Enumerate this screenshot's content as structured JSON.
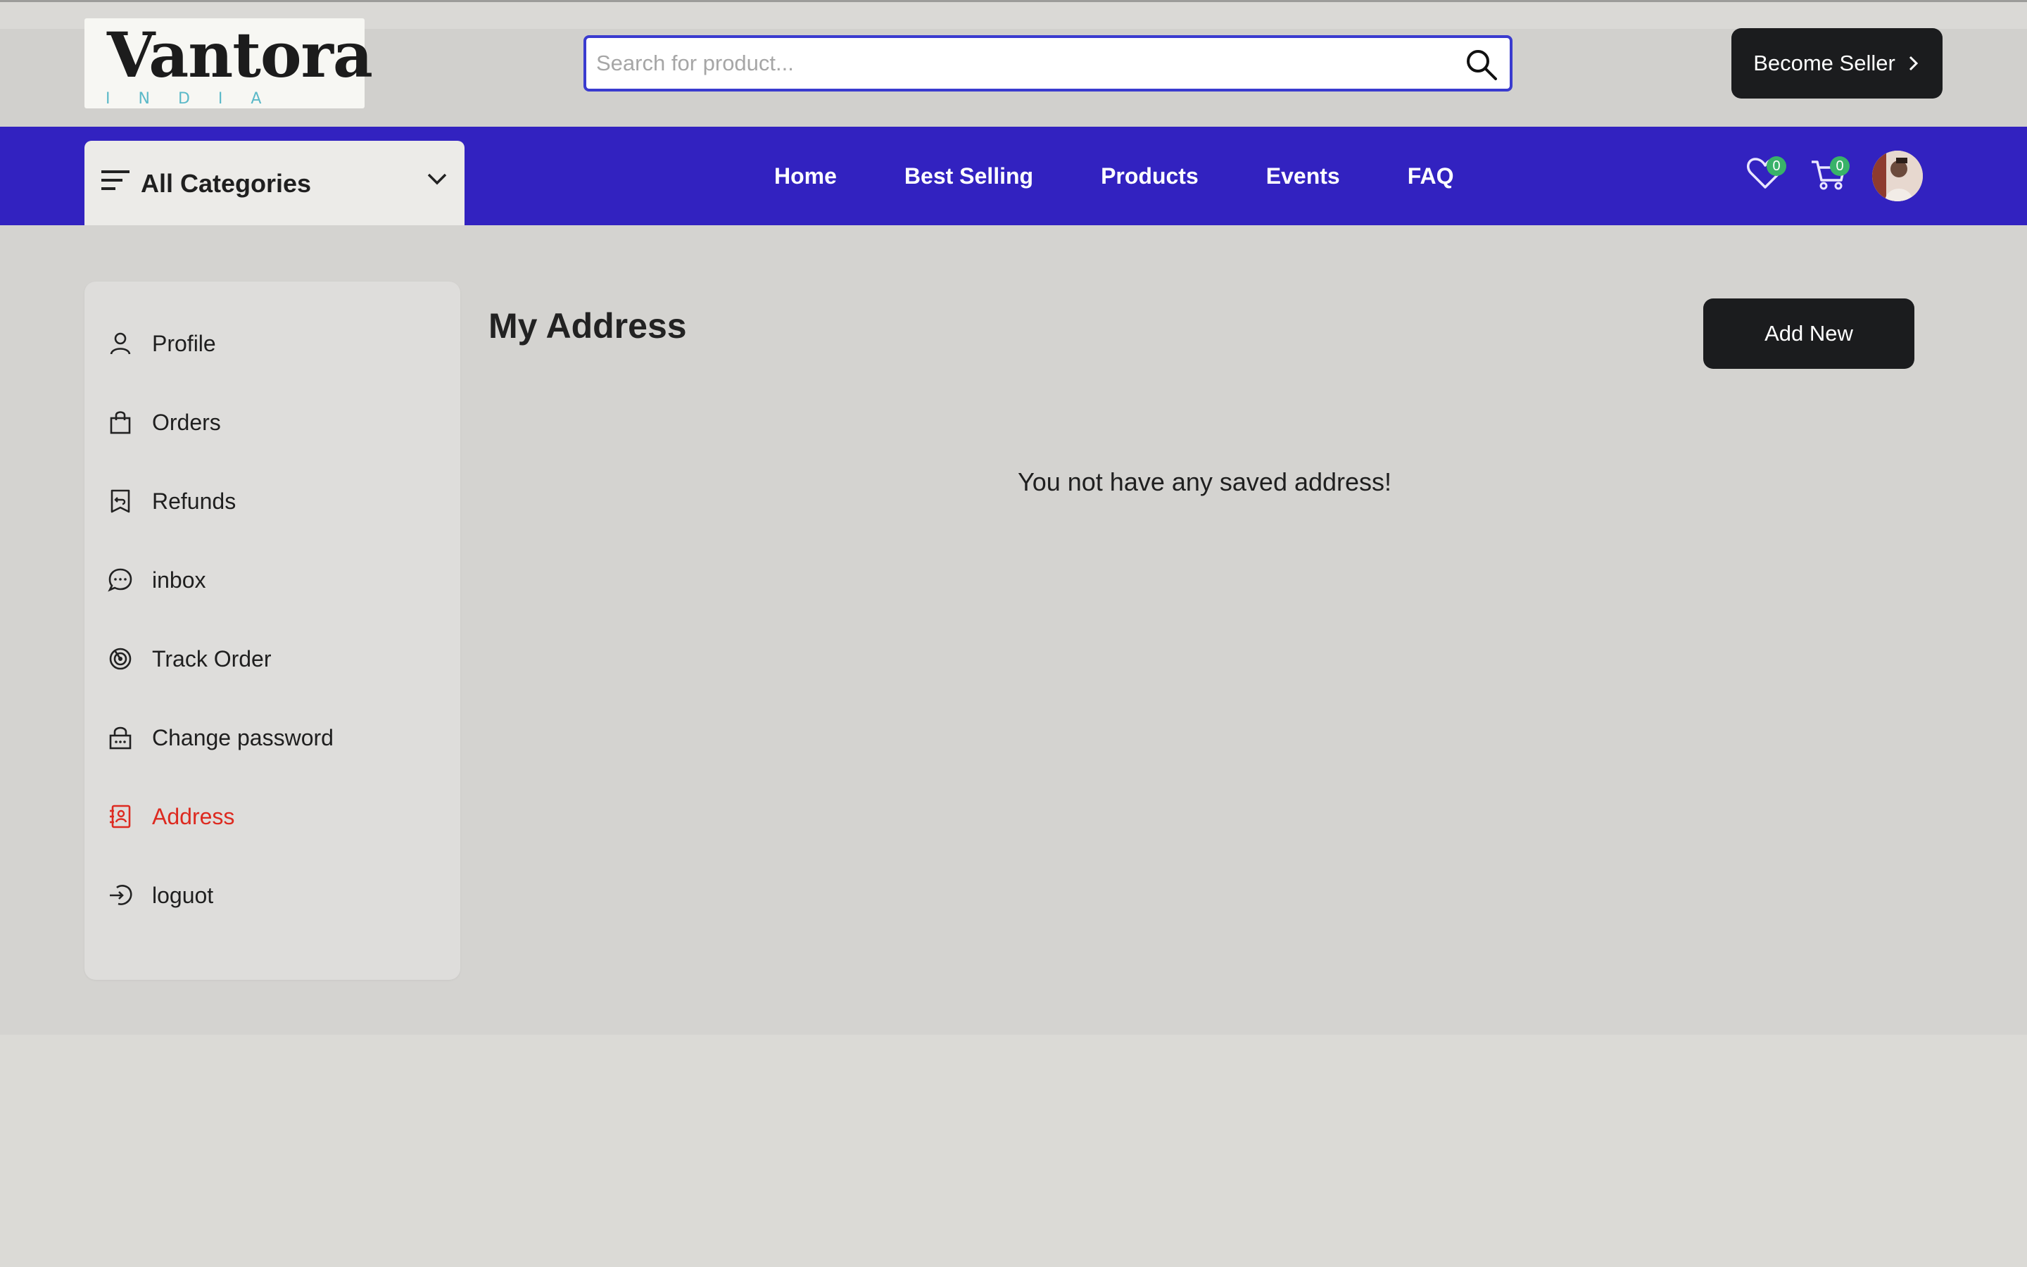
{
  "header": {
    "logo": {
      "brand": "Vantora",
      "sub": "INDIA"
    },
    "search": {
      "placeholder": "Search for product..."
    },
    "become_seller": "Become Seller"
  },
  "nav": {
    "categories_label": "All Categories",
    "links": [
      "Home",
      "Best Selling",
      "Products",
      "Events",
      "FAQ"
    ],
    "wishlist_count": "0",
    "cart_count": "0"
  },
  "sidebar": {
    "items": [
      {
        "label": "Profile",
        "icon": "user-icon"
      },
      {
        "label": "Orders",
        "icon": "shopping-bag-icon"
      },
      {
        "label": "Refunds",
        "icon": "receipt-refund-icon"
      },
      {
        "label": "inbox",
        "icon": "chat-bubble-icon"
      },
      {
        "label": "Track Order",
        "icon": "track-order-icon"
      },
      {
        "label": "Change password",
        "icon": "lock-icon"
      },
      {
        "label": "Address",
        "icon": "address-book-icon",
        "active": true
      },
      {
        "label": "loguot",
        "icon": "logout-icon"
      }
    ]
  },
  "main": {
    "title": "My Address",
    "add_new": "Add New",
    "empty_message": "You not have any saved address!"
  },
  "colors": {
    "nav_bg": "#3222c0",
    "active": "#dd2a20",
    "button_bg": "#1b1c1e",
    "badge": "#39b269"
  }
}
